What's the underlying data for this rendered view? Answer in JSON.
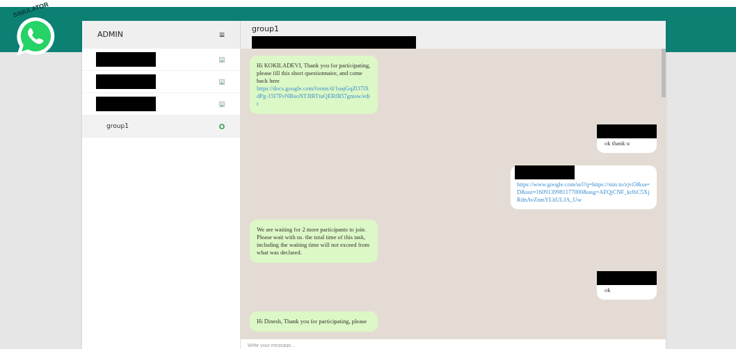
{
  "logo": {
    "caption": "SIMULATOR"
  },
  "sidebar": {
    "title": "ADMIN",
    "menu_icon": "≡",
    "items": [
      {
        "redacted": true,
        "selected": false,
        "kind": "contact"
      },
      {
        "redacted": true,
        "selected": false,
        "kind": "contact"
      },
      {
        "redacted": true,
        "selected": false,
        "kind": "contact"
      },
      {
        "label": "group1",
        "redacted": false,
        "selected": true,
        "kind": "group"
      }
    ]
  },
  "chat": {
    "title": "group1",
    "subtitle_redacted": true,
    "messages": [
      {
        "kind": "in",
        "sender_redacted": false,
        "text": "Hi KOKILADEVI, Thank you for participating, please fill this short questionnaire, and come back here",
        "link": "https://docs.google.com/forms/d/1uajGqZO7lXdPg-15I7FvNBuoNTJIBTtuQERfB57gmsw/edit"
      },
      {
        "kind": "out",
        "sender_redacted": true,
        "text": "ok thank u"
      },
      {
        "kind": "out",
        "sender_redacted": true,
        "link": "https://www.google.com/url?q=https://stin.to/zjvf3&sa=D&ust=1609139981177000&usg=AFQjCNF_kr0iC5XjRdnAvZnmYLhULJA_Uw"
      },
      {
        "kind": "in",
        "sender_redacted": false,
        "text": "We are waiting for 2 more participants to join. Please wait with us. the total time of this task, including the waiting time will not exceed from what was declared."
      },
      {
        "kind": "out",
        "sender_redacted": true,
        "text": "ok"
      },
      {
        "kind": "in",
        "sender_redacted": false,
        "text": "Hi Dinesh, Thank you for participating, please"
      }
    ],
    "input": {
      "placeholder": "Write your message..."
    }
  }
}
